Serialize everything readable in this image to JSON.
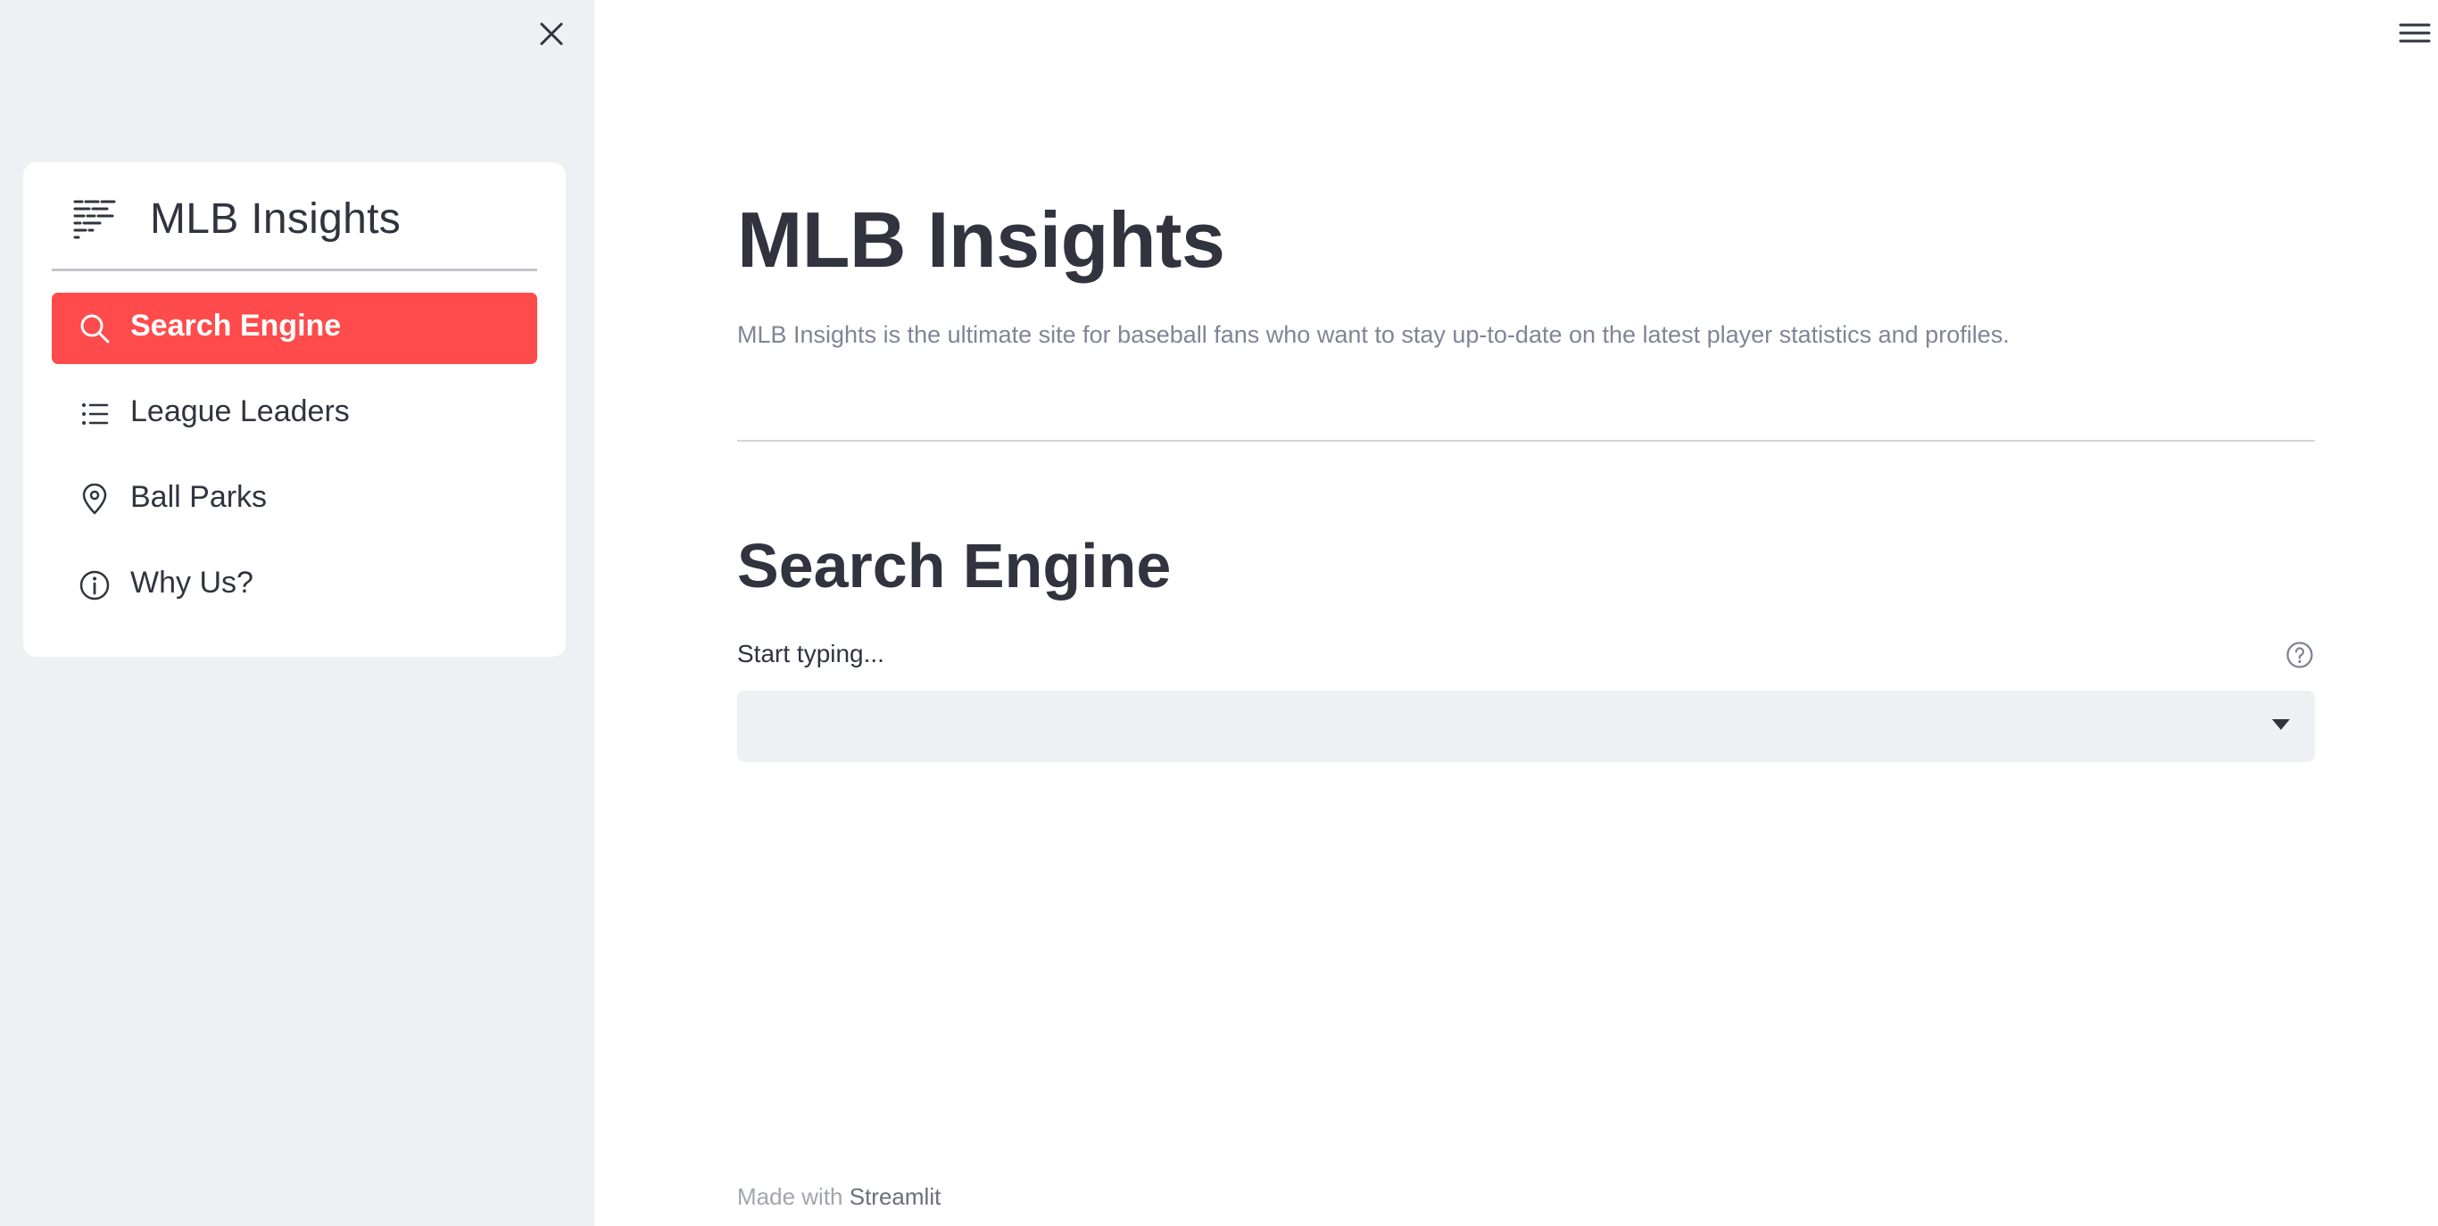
{
  "sidebar": {
    "close_icon": "close-icon",
    "nav": {
      "title": "MLB Insights",
      "logo_icon": "bars-logo-icon",
      "items": [
        {
          "label": "Search Engine",
          "icon": "search-icon",
          "active": true
        },
        {
          "label": "League Leaders",
          "icon": "list-icon",
          "active": false
        },
        {
          "label": "Ball Parks",
          "icon": "map-pin-icon",
          "active": false
        },
        {
          "label": "Why Us?",
          "icon": "info-icon",
          "active": false
        }
      ]
    },
    "accent_color": "#ff4b4b",
    "background_color": "#eef0f4"
  },
  "header": {
    "menu_icon": "hamburger-menu-icon"
  },
  "main": {
    "title": "MLB Insights",
    "description": "MLB Insights is the ultimate site for baseball fans who want to stay up-to-date on the latest player statistics and profiles.",
    "section_title": "Search Engine",
    "search": {
      "label": "Start typing...",
      "value": "",
      "help_icon": "help-circle-icon",
      "dropdown_icon": "caret-down-icon"
    }
  },
  "footer": {
    "prefix": "Made with",
    "link": "Streamlit"
  }
}
